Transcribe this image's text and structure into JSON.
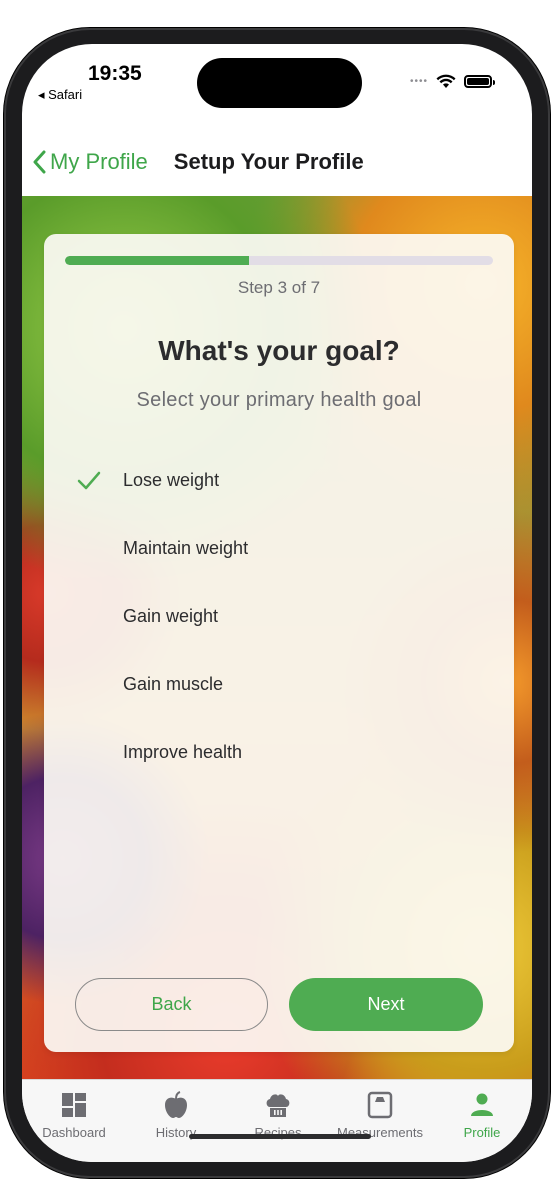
{
  "status": {
    "time": "19:35",
    "back_app": "◂ Safari"
  },
  "nav": {
    "back_label": "My Profile",
    "title": "Setup Your Profile"
  },
  "colors": {
    "accent": "#4fac52",
    "track": "#e2dde6"
  },
  "progress": {
    "step_label": "Step 3 of 7",
    "fraction": 0.43
  },
  "question": {
    "title": "What's your goal?",
    "subtitle": "Select your primary health goal"
  },
  "options": [
    {
      "label": "Lose weight",
      "selected": true
    },
    {
      "label": "Maintain weight",
      "selected": false
    },
    {
      "label": "Gain weight",
      "selected": false
    },
    {
      "label": "Gain muscle",
      "selected": false
    },
    {
      "label": "Improve health",
      "selected": false
    }
  ],
  "buttons": {
    "back": "Back",
    "next": "Next"
  },
  "tabs": [
    {
      "label": "Dashboard",
      "icon": "dashboard-icon",
      "active": false
    },
    {
      "label": "History",
      "icon": "apple-icon",
      "active": false
    },
    {
      "label": "Recipes",
      "icon": "chef-hat-icon",
      "active": false
    },
    {
      "label": "Measurements",
      "icon": "scale-icon",
      "active": false
    },
    {
      "label": "Profile",
      "icon": "person-icon",
      "active": true
    }
  ]
}
